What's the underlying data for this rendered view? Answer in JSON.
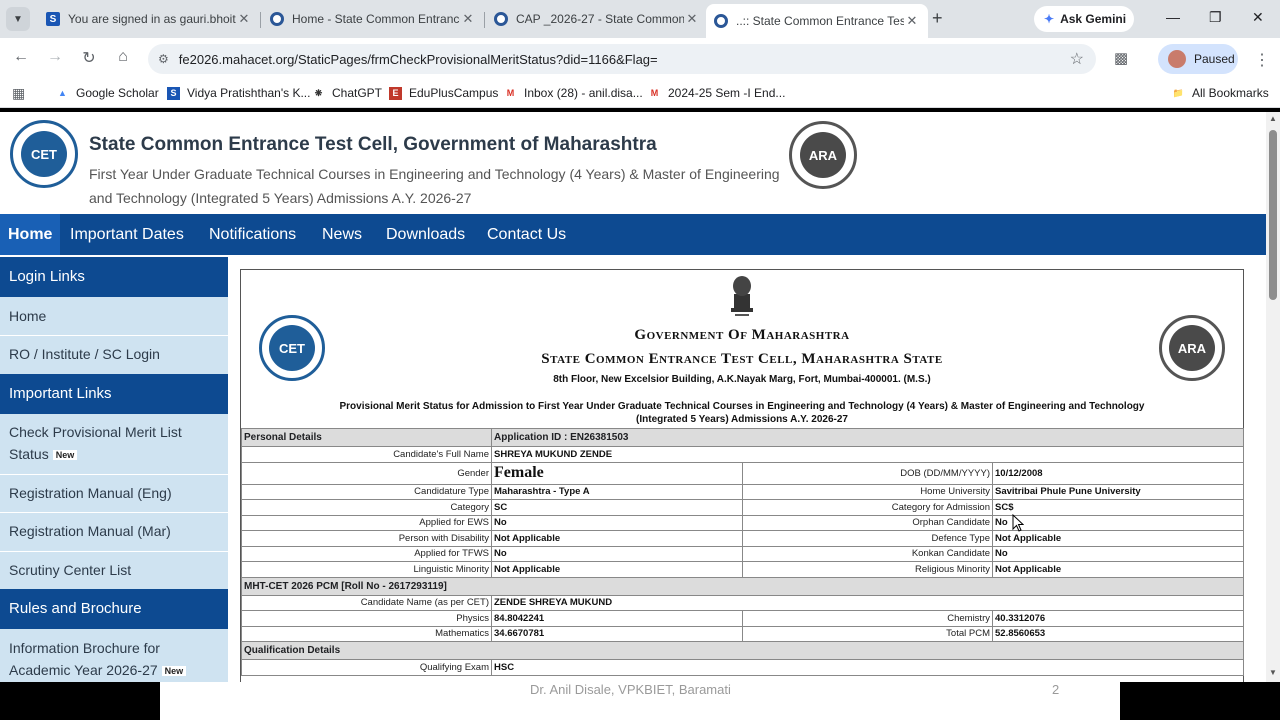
{
  "browser": {
    "tabs": [
      {
        "title": "You are signed in as gauri.bhoit",
        "active": false
      },
      {
        "title": "Home - State Common Entrance",
        "active": false
      },
      {
        "title": "CAP _2026-27 - State Common",
        "active": false
      },
      {
        "title": "..:: State Common Entrance Test",
        "active": true
      }
    ],
    "ask_gemini": "Ask Gemini",
    "url": "fe2026.mahacet.org/StaticPages/frmCheckProvisionalMeritStatus?did=1166&Flag=",
    "profile_label": "Paused",
    "bookmarks": [
      "Google Scholar",
      "Vidya Pratishthan's K...",
      "ChatGPT",
      "EduPlusCampus",
      "Inbox (28) - anil.disa...",
      "2024-25 Sem -I End..."
    ],
    "all_bookmarks": "All Bookmarks"
  },
  "site": {
    "title": "State Common Entrance Test Cell, Government of Maharashtra",
    "subtitle": "First Year Under Graduate Technical Courses in Engineering and Technology (4 Years) & Master of Engineering and Technology (Integrated 5 Years) Admissions A.Y. 2026-27",
    "logo_left": "CET",
    "logo_right": "ARA"
  },
  "nav": [
    "Home",
    "Important Dates",
    "Notifications",
    "News",
    "Downloads",
    "Contact Us"
  ],
  "sidebar": {
    "login_head": "Login Links",
    "login_links": [
      "Home",
      "RO / Institute / SC Login"
    ],
    "important_head": "Important Links",
    "important_links": [
      "Check Provisional Merit List Status",
      "Registration Manual (Eng)",
      "Registration Manual (Mar)",
      "Scrutiny Center List"
    ],
    "rules_head": "Rules and Brochure",
    "rules_links": [
      "Information Brochure for Academic Year 2026-27"
    ],
    "new_badge": "New"
  },
  "document": {
    "gov_line1": "Government Of Maharashtra",
    "gov_line2": "State Common Entrance Test Cell, Maharashtra State",
    "address": "8th Floor, New Excelsior Building, A.K.Nayak Marg, Fort, Mumbai-400001. (M.S.)",
    "heading": "Provisional Merit Status for Admission to First Year Under Graduate Technical Courses in Engineering and Technology (4 Years) & Master of Engineering and Technology (Integrated 5 Years) Admissions A.Y. 2026-27",
    "personal_section": "Personal Details",
    "application_id": "Application ID : EN26381503",
    "full_name_label": "Candidate's Full Name",
    "full_name": "SHREYA MUKUND ZENDE",
    "gender_label": "Gender",
    "gender": "Female",
    "dob_label": "DOB (DD/MM/YYYY)",
    "dob": "10/12/2008",
    "candidature_label": "Candidature Type",
    "candidature": "Maharashtra - Type A",
    "home_univ_label": "Home University",
    "home_univ": "Savitribai Phule Pune University",
    "category_label": "Category",
    "category": "SC",
    "cat_admission_label": "Category for Admission",
    "cat_admission": "SC$",
    "ews_label": "Applied for EWS",
    "ews": "No",
    "orphan_label": "Orphan Candidate",
    "orphan": "No",
    "pwd_label": "Person with Disability",
    "pwd": "Not Applicable",
    "defence_label": "Defence Type",
    "defence": "Not Applicable",
    "tfws_label": "Applied for TFWS",
    "tfws": "No",
    "konkan_label": "Konkan Candidate",
    "konkan": "No",
    "ling_label": "Linguistic Minority",
    "ling": "Not Applicable",
    "relig_label": "Religious Minority",
    "relig": "Not Applicable",
    "cet_section": "MHT-CET 2026 PCM [Roll No - 2617293119]",
    "cet_name_label": "Candidate Name (as per CET)",
    "cet_name": "ZENDE SHREYA MUKUND",
    "physics_label": "Physics",
    "physics": "84.8042241",
    "chemistry_label": "Chemistry",
    "chemistry": "40.3312076",
    "maths_label": "Mathematics",
    "maths": "34.6670781",
    "total_label": "Total PCM",
    "total": "52.8560653",
    "qual_section": "Qualification Details",
    "qual_exam_label": "Qualifying Exam",
    "qual_exam": "HSC"
  },
  "footer": {
    "caption": "Dr. Anil Disale, VPKBIET, Baramati",
    "page": "2"
  }
}
